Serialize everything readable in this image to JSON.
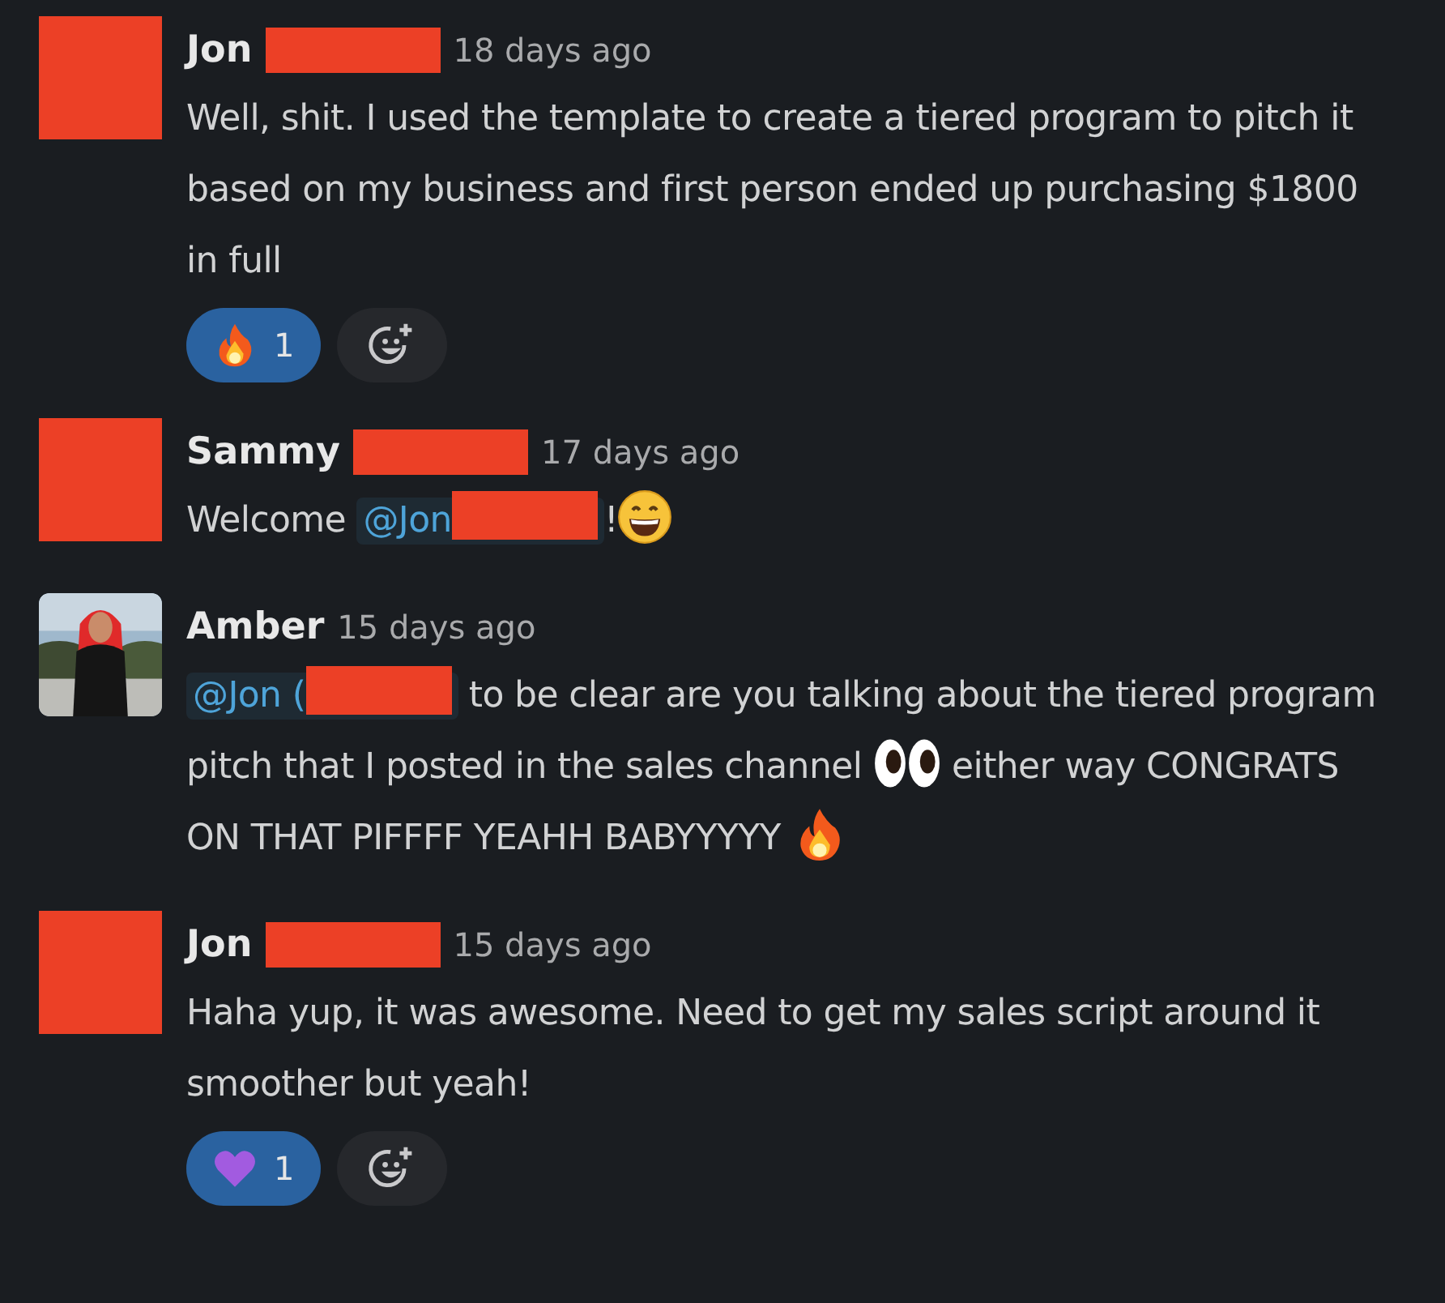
{
  "messages": [
    {
      "author": "Jon",
      "author_redacted": true,
      "time": "18 days ago",
      "avatar": {
        "kind": "redaction"
      },
      "body": [
        {
          "kind": "text",
          "text": "Well, shit. I used the template to create a tiered program to pitch it based on my business and first person ended up purchasing $1800 in full"
        }
      ],
      "reactions": [
        {
          "kind": "fire",
          "count": "1",
          "selected": true
        }
      ]
    },
    {
      "author": "Sammy",
      "author_redacted": true,
      "time": "17 days ago",
      "avatar": {
        "kind": "redaction"
      },
      "body": [
        {
          "kind": "text",
          "text": "Welcome "
        },
        {
          "kind": "mention",
          "text": "@Jon",
          "redacted": true
        },
        {
          "kind": "text",
          "text": "!"
        },
        {
          "kind": "grin"
        }
      ]
    },
    {
      "author": "Amber",
      "author_redacted": false,
      "time": "15 days ago",
      "body": [
        {
          "kind": "mention",
          "text": "@Jon (",
          "redacted": true
        },
        {
          "kind": "text",
          "text": " to be clear are you talking about the tiered program pitch that I posted in the sales channel "
        },
        {
          "kind": "eyes"
        },
        {
          "kind": "text",
          "text": " either way CONGRATS ON THAT PIFFFF YEAHH BABYYYYY "
        },
        {
          "kind": "fire"
        }
      ]
    },
    {
      "author": "Jon",
      "author_redacted": true,
      "time": "15 days ago",
      "avatar": {
        "kind": "redaction"
      },
      "body": [
        {
          "kind": "text",
          "text": "Haha yup, it was awesome. Need to get my sales script around it smoother but yeah!"
        }
      ],
      "reactions": [
        {
          "kind": "purple-heart",
          "count": "1",
          "selected": true
        }
      ]
    }
  ]
}
